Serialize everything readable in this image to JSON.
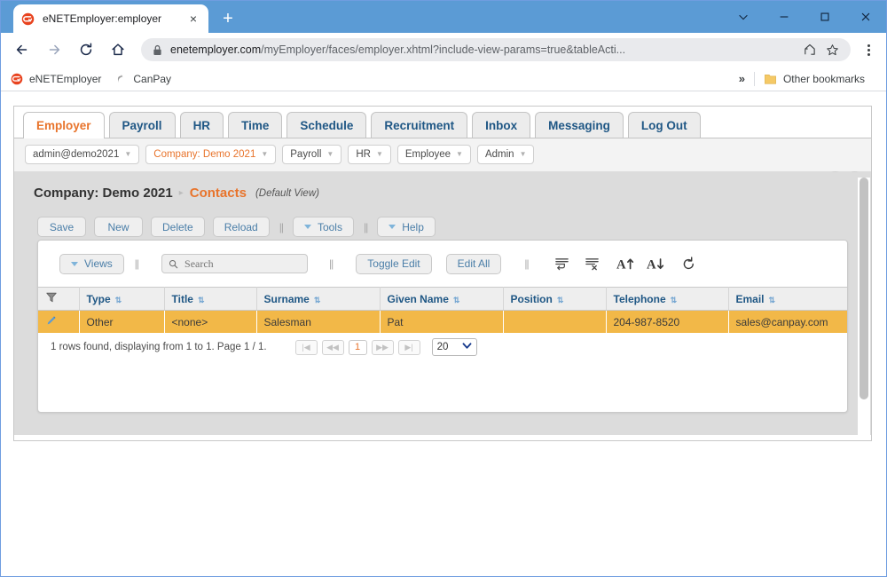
{
  "browser": {
    "tab": {
      "title": "eNETEmployer:employer",
      "favicon": "enetemployer-logo-icon",
      "close": "×"
    },
    "newtab_label": "+",
    "window_controls": {
      "more": "chevron-down",
      "minimize": "—",
      "maximize": "□",
      "close": "✕"
    },
    "nav": {
      "back": "←",
      "forward": "→",
      "reload": "⟳",
      "home": "⌂"
    },
    "url": {
      "domain": "enetemployer.com",
      "path": "/myEmployer/faces/employer.xhtml?include-view-params=true&tableActi...",
      "lock": "lock-icon",
      "share": "share-icon",
      "bookmark": "star-icon"
    },
    "bookmarks": [
      {
        "label": "eNETEmployer",
        "icon": "enetemployer-logo-icon"
      },
      {
        "label": "CanPay",
        "icon": "canpay-logo-icon"
      }
    ],
    "bookmarks_overflow": "»",
    "other_bookmarks": {
      "label": "Other bookmarks",
      "icon": "folder-icon"
    }
  },
  "app": {
    "main_tabs": [
      {
        "label": "Employer",
        "active": true
      },
      {
        "label": "Payroll",
        "active": false
      },
      {
        "label": "HR",
        "active": false
      },
      {
        "label": "Time",
        "active": false
      },
      {
        "label": "Schedule",
        "active": false
      },
      {
        "label": "Recruitment",
        "active": false
      },
      {
        "label": "Inbox",
        "active": false
      },
      {
        "label": "Messaging",
        "active": false
      },
      {
        "label": "Log Out",
        "active": false
      }
    ],
    "sub_menu": [
      {
        "label": "admin@demo2021",
        "accent": false
      },
      {
        "label": "Company: Demo 2021",
        "accent": true
      },
      {
        "label": "Payroll",
        "accent": false
      },
      {
        "label": "HR",
        "accent": false
      },
      {
        "label": "Employee",
        "accent": false
      },
      {
        "label": "Admin",
        "accent": false
      }
    ],
    "breadcrumb": {
      "company": "Company: Demo 2021",
      "separator": "▸",
      "page": "Contacts",
      "view": "(Default View)"
    },
    "panel_icons": [
      {
        "name": "settings-gear-icon",
        "glyph": "⚙"
      },
      {
        "name": "minimize-panel-icon",
        "glyph": "–"
      }
    ],
    "action_buttons": [
      {
        "label": "Save",
        "caret": false
      },
      {
        "label": "New",
        "caret": false
      },
      {
        "label": "Delete",
        "caret": false
      },
      {
        "label": "Reload",
        "caret": false
      },
      {
        "label": "Tools",
        "caret": true
      },
      {
        "label": "Help",
        "caret": true
      }
    ],
    "card_tools": {
      "views_label": "Views",
      "search_placeholder": "Search",
      "search_value": "",
      "toggle_edit_label": "Toggle Edit",
      "edit_all_label": "Edit All",
      "icons": [
        {
          "name": "insert-row-icon"
        },
        {
          "name": "delete-row-icon"
        },
        {
          "name": "sort-ascending-icon",
          "glyph": "A↑"
        },
        {
          "name": "sort-descending-icon",
          "glyph": "A↓"
        },
        {
          "name": "refresh-icon",
          "glyph": "↺"
        }
      ]
    },
    "table": {
      "filter_icon": "filter-funnel-icon",
      "columns": [
        "Type",
        "Title",
        "Surname",
        "Given Name",
        "Position",
        "Telephone",
        "Email"
      ],
      "sort_glyph": "⇅",
      "rows": [
        {
          "edit_icon": "edit-pencil-icon",
          "Type": "Other",
          "Title": "<none>",
          "Surname": "Salesman",
          "Given Name": "Pat",
          "Position": "",
          "Telephone": "204-987-8520",
          "Email": "sales@canpay.com"
        }
      ]
    },
    "pager": {
      "status": "1 rows found, displaying from 1 to 1. Page 1 / 1.",
      "first": "|◀",
      "prev": "◀◀",
      "current": "1",
      "next": "▶▶",
      "last": "▶|",
      "page_size": "20",
      "page_size_caret": "▼"
    }
  },
  "colors": {
    "accent_orange": "#e8742c",
    "row_highlight": "#f2b848",
    "header_blue": "#1f5785",
    "titlebar_blue": "#5b9bd5"
  }
}
